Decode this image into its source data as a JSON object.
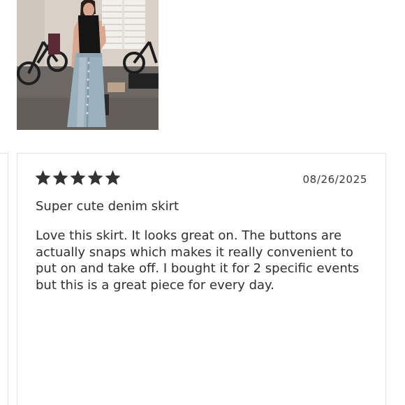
{
  "review": {
    "photo": {
      "icon": "review-photo",
      "description_hidden": ""
    },
    "rating": 5,
    "rating_max": 5,
    "star_color": "#333333",
    "date": "08/26/2025",
    "title": "Super cute denim skirt",
    "body": "Love this skirt. It looks great on. The buttons are actually snaps which makes it really convenient to put on and take off. I bought it for 2 specific events but this is a great piece for every day."
  }
}
